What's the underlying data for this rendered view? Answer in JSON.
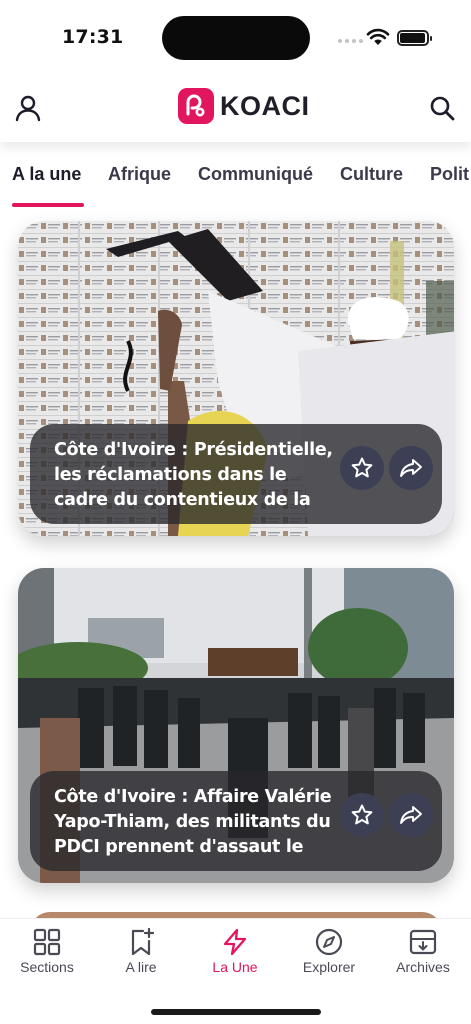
{
  "status_bar": {
    "time": "17:31"
  },
  "header": {
    "brand": "KOACI"
  },
  "tabs": [
    {
      "label": "A la une",
      "active": true
    },
    {
      "label": "Afrique"
    },
    {
      "label": "Communiqué"
    },
    {
      "label": "Culture"
    },
    {
      "label": "Polit"
    }
  ],
  "articles": [
    {
      "title": "Côte d'Ivoire : Présidentielle, les réclamations dans le cadre du contentieux de la liste"
    },
    {
      "title": "Côte d'Ivoire : Affaire Valérie Yapo-Thiam, des militants du PDCI prennent d'assaut le"
    }
  ],
  "bottom_nav": [
    {
      "label": "Sections",
      "icon": "grid-icon"
    },
    {
      "label": "A lire",
      "icon": "bookmark-add-icon"
    },
    {
      "label": "La Une",
      "icon": "lightning-icon",
      "active": true
    },
    {
      "label": "Explorer",
      "icon": "compass-icon"
    },
    {
      "label": "Archives",
      "icon": "archive-icon"
    }
  ],
  "colors": {
    "accent": "#e2165e",
    "caption_bg": "#28282c",
    "action_button": "#3d3f55"
  }
}
